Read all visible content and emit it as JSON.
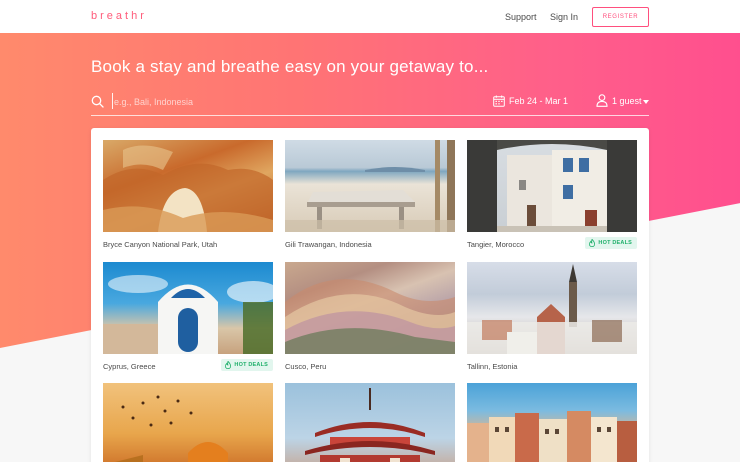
{
  "header": {
    "logo": "breathr",
    "nav": {
      "support": "Support",
      "sign_in": "Sign In"
    },
    "register_label": "REGISTER"
  },
  "hero": {
    "headline": "Book a stay and breathe easy on your getaway to...",
    "search": {
      "placeholder": "e.g., Bali, Indonesia",
      "value": "",
      "dates": "Feb 24 - Mar 1",
      "guests": "1 guest"
    }
  },
  "destinations": [
    {
      "name": "Bryce Canyon National Park, Utah",
      "badge": ""
    },
    {
      "name": "Gili Trawangan, Indonesia",
      "badge": ""
    },
    {
      "name": "Tangier, Morocco",
      "badge": "HOT DEALS"
    },
    {
      "name": "Cyprus, Greece",
      "badge": "HOT DEALS"
    },
    {
      "name": "Cusco, Peru",
      "badge": ""
    },
    {
      "name": "Tallinn, Estonia",
      "badge": ""
    },
    {
      "name": "",
      "badge": ""
    },
    {
      "name": "",
      "badge": ""
    },
    {
      "name": "",
      "badge": ""
    }
  ],
  "icons": {
    "search": "search-icon",
    "calendar": "calendar-icon",
    "guests": "user-icon",
    "dropdown": "chevron-down-icon",
    "badge": "flame-icon"
  },
  "colors": {
    "brand": "#ff5b7a",
    "hero_start": "#ff8a6c",
    "hero_end": "#ff4f8e",
    "badge_bg": "#e2f6ee",
    "badge_text": "#20b06b"
  }
}
